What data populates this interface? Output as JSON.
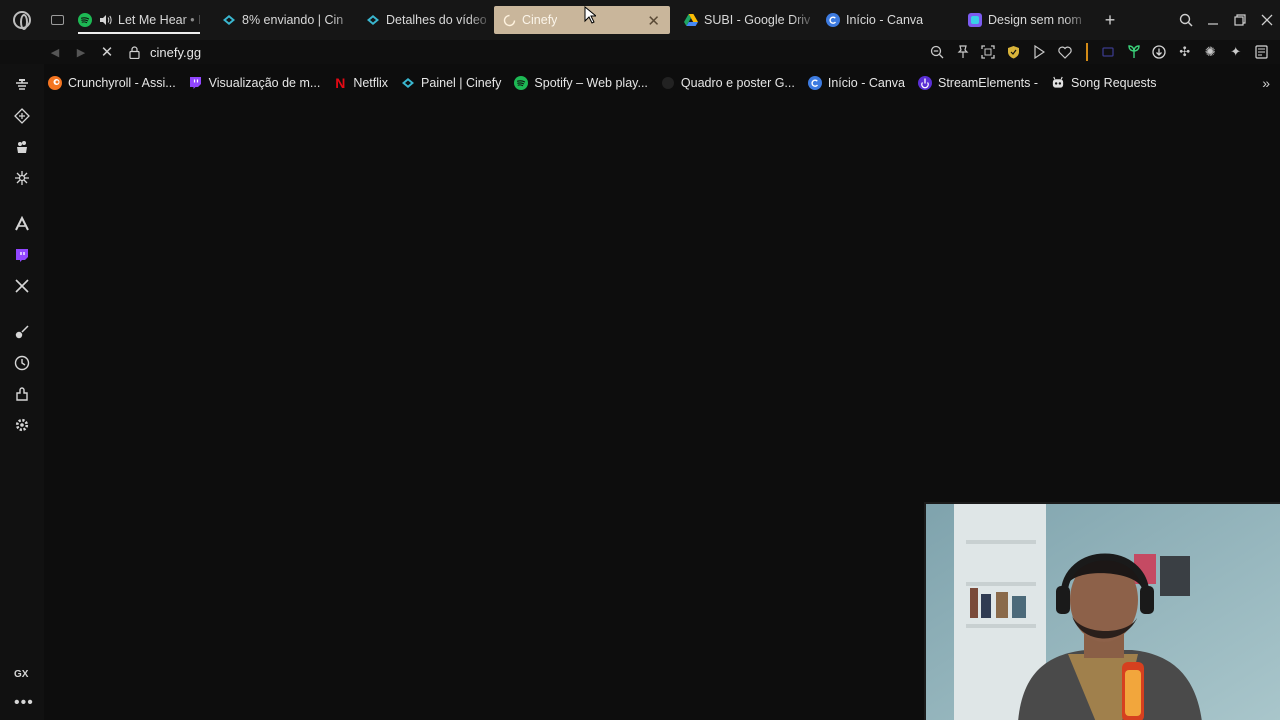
{
  "browser": {
    "address": {
      "url": "cinefy.gg"
    },
    "tabs": [
      {
        "label": "Let Me Hear • F",
        "icon": "spotify-icon",
        "color": "#1db954",
        "audio": true
      },
      {
        "label": "8% enviando | Cin",
        "icon": "cinefy-icon",
        "color": "#3ab7d0"
      },
      {
        "label": "Detalhes do vídeo",
        "icon": "cinefy-icon",
        "color": "#3ab7d0"
      },
      {
        "label": "Cinefy",
        "icon": "loading-icon",
        "active": true
      },
      {
        "label": "SUBI - Google Driv",
        "icon": "google-drive-icon"
      },
      {
        "label": "Início - Canva",
        "icon": "canva-icon",
        "color": "#3d7be0"
      },
      {
        "label": "Design sem nome",
        "icon": "canva-design-icon",
        "color": "#7b5cf0"
      }
    ],
    "bookmarks": [
      {
        "label": "Crunchyroll - Assi...",
        "icon": "crunchyroll-icon",
        "color": "#f47521"
      },
      {
        "label": "Visualização de m...",
        "icon": "twitch-icon",
        "color": "#9146ff"
      },
      {
        "label": "Netflix",
        "icon": "netflix-icon",
        "color": "#e50914"
      },
      {
        "label": "Painel | Cinefy",
        "icon": "cinefy-icon",
        "color": "#3ab7d0"
      },
      {
        "label": "Spotify – Web play...",
        "icon": "spotify-icon",
        "color": "#1db954"
      },
      {
        "label": "Quadro e poster G...",
        "icon": "generic-site-icon",
        "color": "#222222"
      },
      {
        "label": "Início - Canva",
        "icon": "canva-icon",
        "color": "#3d7be0"
      },
      {
        "label": "StreamElements -",
        "icon": "streamelements-icon",
        "color": "#5a2fd6"
      },
      {
        "label": "Song Requests",
        "icon": "robot-icon",
        "color": "#e0e0e0"
      }
    ],
    "sidebar": {
      "gx_label": "GX"
    },
    "colors": {
      "accent": "#c9b69b",
      "tool_separator": "#d38b17",
      "background": "#0d0d0d"
    }
  }
}
